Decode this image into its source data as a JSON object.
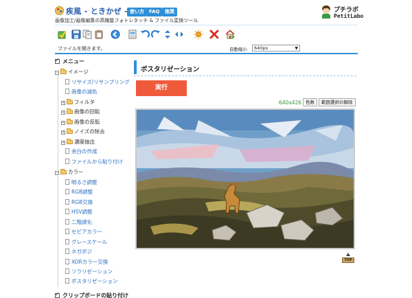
{
  "header": {
    "site_title": "疾風 - ときかぜ -",
    "subtitle": "画像加工/画像編集の高機能フォトレタッチ & ファイル変換ツール",
    "nav": [
      "使い方",
      "FAQ",
      "推奨"
    ],
    "brand_jp": "プチラボ",
    "brand_en": "PetitLabo"
  },
  "toolbar": {
    "icons": [
      "check-icon",
      "save-icon",
      "copy-icon",
      "paste-icon",
      "back-icon",
      "file-icon",
      "undo-icon",
      "redo-icon",
      "flip-vertical-icon",
      "flip-horizontal-icon",
      "sun-icon",
      "delete-icon",
      "home-icon"
    ]
  },
  "status": {
    "message": "ファイルを開きます。",
    "zoom_label": "自動縮小",
    "zoom_value": "640px"
  },
  "sidebar": {
    "menu_label": "メニュー",
    "image_group": "イメージ",
    "image_items": [
      {
        "label": "リサイズ/リサンプリング",
        "type": "link"
      },
      {
        "label": "画像の減色",
        "type": "link"
      },
      {
        "label": "フィルタ",
        "type": "folder"
      },
      {
        "label": "画像の回転",
        "type": "folder"
      },
      {
        "label": "画像の反転",
        "type": "folder"
      },
      {
        "label": "ノイズの除去",
        "type": "folder"
      },
      {
        "label": "濃度抽出",
        "type": "folder"
      },
      {
        "label": "余白の作成",
        "type": "link"
      },
      {
        "label": "ファイルから貼り付け",
        "type": "link"
      }
    ],
    "color_group": "カラー",
    "color_items": [
      "明るさ調整",
      "RGB調整",
      "RGB交換",
      "HSV調整",
      "二階調化",
      "セピアカラー",
      "グレースケール",
      "ネガポジ",
      "XORカラー交換",
      "ソラリゼーション",
      "ポスタリゼーション"
    ],
    "clipboard_label": "クリップボードの貼り付け"
  },
  "main": {
    "title": "ポスタリゼーション",
    "run_label": "実行",
    "image_size": "640x426",
    "color_button": "色数",
    "clear_selection_button": "範囲選択の解除",
    "top_label": "TOP"
  },
  "colors": {
    "accent": "#2f8fd8",
    "run": "#ef5a3c",
    "link": "#2b6fc2",
    "size_text": "#3a9a3a"
  }
}
